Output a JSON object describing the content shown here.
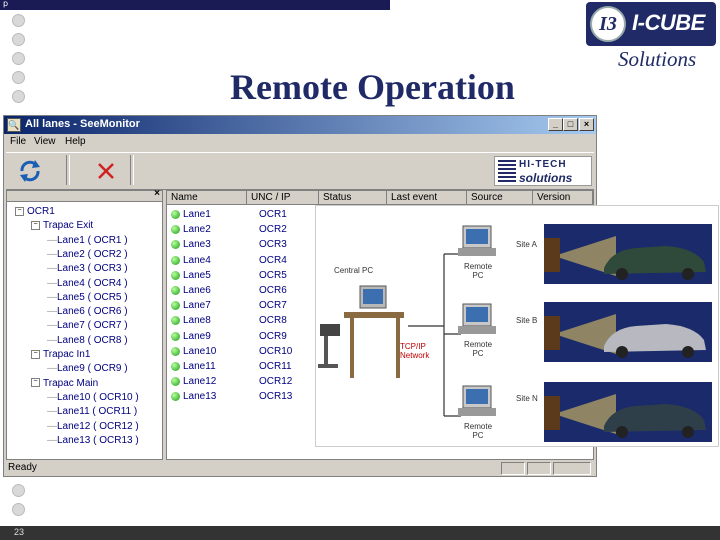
{
  "slide": {
    "title": "Remote Operation",
    "page_number": "23",
    "top_mark": "p"
  },
  "logo": {
    "mark": "I3",
    "name": "I-CUBE",
    "tagline": "Solutions"
  },
  "window": {
    "title": "All lanes - SeeMonitor",
    "menus": [
      "File",
      "View",
      "Help"
    ],
    "toolbar": {
      "refresh_icon": "refresh-icon",
      "delete_icon": "close-x-icon",
      "brand_top": "HI-TECH",
      "brand_bottom": "solutions"
    },
    "tree": {
      "root": "OCR1",
      "groups": [
        {
          "label": "Trapac Exit",
          "children": [
            "Lane1 ( OCR1 )",
            "Lane2 ( OCR2 )",
            "Lane3 ( OCR3 )",
            "Lane4 ( OCR4 )",
            "Lane5 ( OCR5 )",
            "Lane6 ( OCR6 )",
            "Lane7 ( OCR7 )",
            "Lane8 ( OCR8 )"
          ]
        },
        {
          "label": "Trapac In1",
          "children": [
            "Lane9 ( OCR9 )"
          ]
        },
        {
          "label": "Trapac Main",
          "children": [
            "Lane10 ( OCR10 )",
            "Lane11 ( OCR11 )",
            "Lane12 ( OCR12 )",
            "Lane13 ( OCR13 )"
          ]
        }
      ]
    },
    "columns": [
      "Name",
      "UNC / IP",
      "Status",
      "Last event",
      "Source",
      "Version"
    ],
    "lanes": [
      {
        "name": "Lane1",
        "ocr": "OCR1"
      },
      {
        "name": "Lane2",
        "ocr": "OCR2"
      },
      {
        "name": "Lane3",
        "ocr": "OCR3"
      },
      {
        "name": "Lane4",
        "ocr": "OCR4"
      },
      {
        "name": "Lane5",
        "ocr": "OCR5"
      },
      {
        "name": "Lane6",
        "ocr": "OCR6"
      },
      {
        "name": "Lane7",
        "ocr": "OCR7"
      },
      {
        "name": "Lane8",
        "ocr": "OCR8"
      },
      {
        "name": "Lane9",
        "ocr": "OCR9"
      },
      {
        "name": "Lane10",
        "ocr": "OCR10"
      },
      {
        "name": "Lane11",
        "ocr": "OCR11"
      },
      {
        "name": "Lane12",
        "ocr": "OCR12"
      },
      {
        "name": "Lane13",
        "ocr": "OCR13"
      }
    ],
    "status": "Ready"
  },
  "diagram": {
    "central": "Central PC",
    "network": "TCP/IP\nNetwork",
    "remotes": [
      "Remote\nPC",
      "Remote\nPC",
      "Remote\nPC"
    ],
    "sites": [
      "Site A",
      "Site B",
      "Site N"
    ]
  }
}
